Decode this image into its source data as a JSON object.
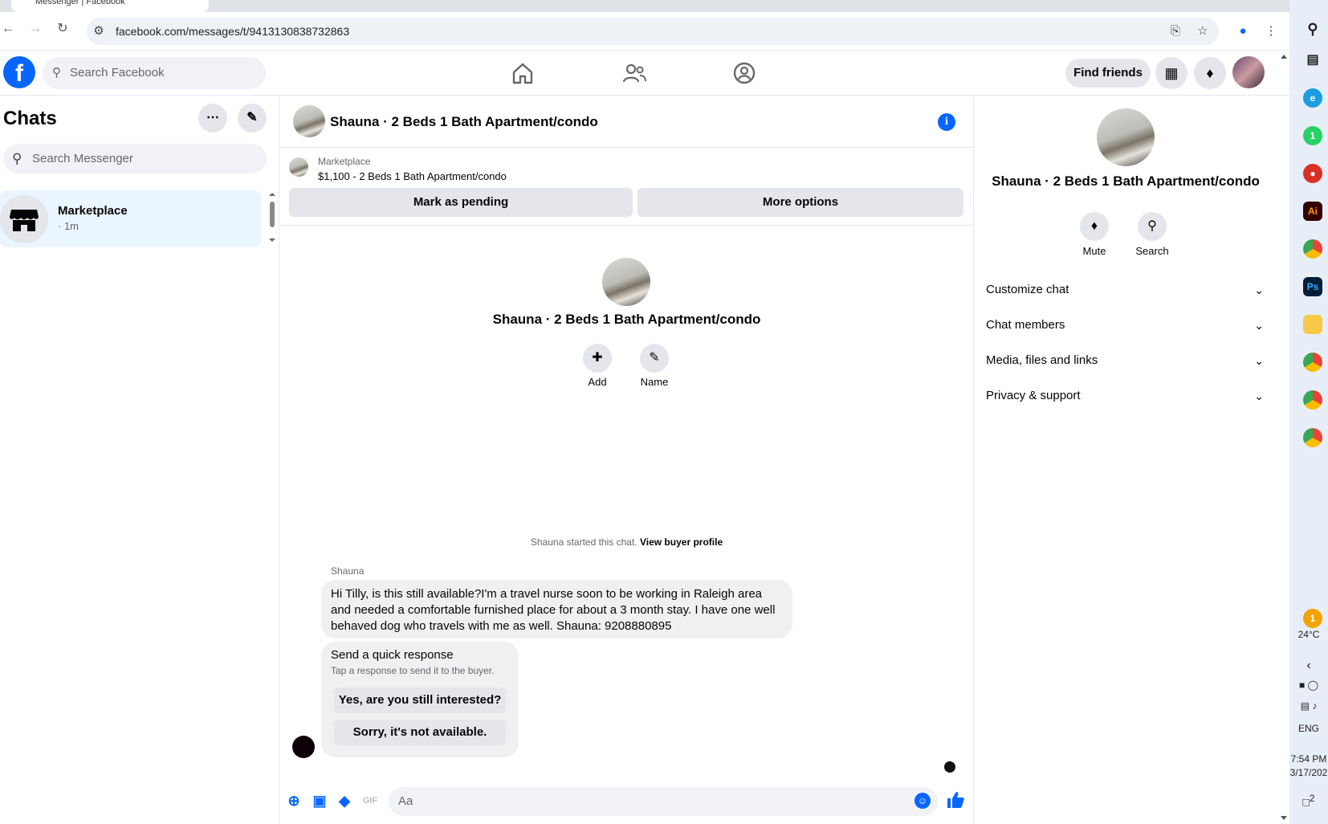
{
  "browser": {
    "tab_title": "Messenger | Facebook",
    "url": "facebook.com/messages/t/9413130838732863"
  },
  "fb_header": {
    "logo": "f",
    "search_placeholder": "Search Facebook",
    "find_friends": "Find friends"
  },
  "sidebar": {
    "title": "Chats",
    "search_placeholder": "Search Messenger",
    "chats": [
      {
        "name": "Marketplace",
        "time": "· 1m"
      }
    ]
  },
  "chat": {
    "title": "Shauna · 2 Beds 1 Bath Apartment/condo",
    "info_glyph": "i",
    "marketplace_label": "Marketplace",
    "listing_price_line": "$1,100 - 2 Beds 1 Bath Apartment/condo",
    "mark_pending": "Mark as pending",
    "more_options": "More options",
    "center_title": "Shauna · 2 Beds 1 Bath Apartment/condo",
    "add_label": "Add",
    "name_label": "Name",
    "started_text": "Shauna started this chat.",
    "view_buyer_profile": "View buyer profile",
    "sender": "Shauna",
    "message": "Hi Tilly, is this still available?I'm a travel nurse soon to be working in Raleigh area and needed a comfortable furnished place for about a 3 month stay. I have one well behaved dog who travels with me as well. Shauna: 9208880895",
    "quick_title": "Send a quick response",
    "quick_subtitle": "Tap a response to send it to the buyer.",
    "quick_options": [
      "Yes, are you still interested?",
      "Sorry, it's not available."
    ],
    "composer_placeholder": "Aa"
  },
  "right_panel": {
    "title": "Shauna · 2 Beds 1 Bath Apartment/condo",
    "mute": "Mute",
    "search": "Search",
    "sections": [
      "Customize chat",
      "Chat members",
      "Media, files and links",
      "Privacy & support"
    ]
  },
  "taskbar": {
    "temperature": "24°C",
    "language": "ENG",
    "time": "7:54 PM",
    "date": "3/17/202",
    "weather_badge": "1",
    "notif_badge": "2",
    "whatsapp_badge": "1",
    "ai_label": "Ai",
    "ps_label": "Ps"
  },
  "colors": {
    "accent": "#0866ff",
    "selected_chat": "#ebf5ff",
    "button_gray": "#e4e6eb",
    "bubble_gray": "#f0f0f0"
  }
}
